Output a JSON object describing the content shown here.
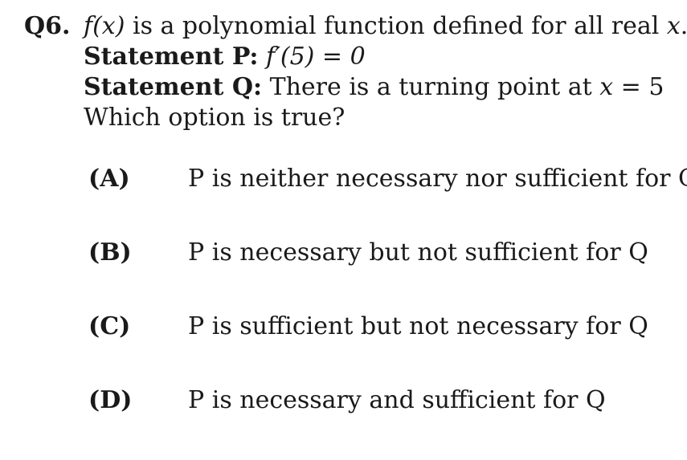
{
  "question": {
    "number": "Q6.",
    "stem_func": "f(x)",
    "stem_rest": " is a polynomial function defined for all real ",
    "stem_var": "x",
    "stem_end": ".",
    "statement_p_label": "Statement P:",
    "statement_p_text": "f′(5) = 0",
    "statement_q_label": "Statement Q:",
    "statement_q_text_pre": " There is a turning point at ",
    "statement_q_var": "x",
    "statement_q_text_post": " = 5",
    "prompt": "Which option is true?"
  },
  "options": [
    {
      "label": "(A)",
      "text": "P is neither necessary nor sufficient for Q"
    },
    {
      "label": "(B)",
      "text": "P is necessary but not sufficient for Q"
    },
    {
      "label": "(C)",
      "text": "P is sufficient but not necessary for Q"
    },
    {
      "label": "(D)",
      "text": "P is necessary and sufficient for Q"
    }
  ]
}
